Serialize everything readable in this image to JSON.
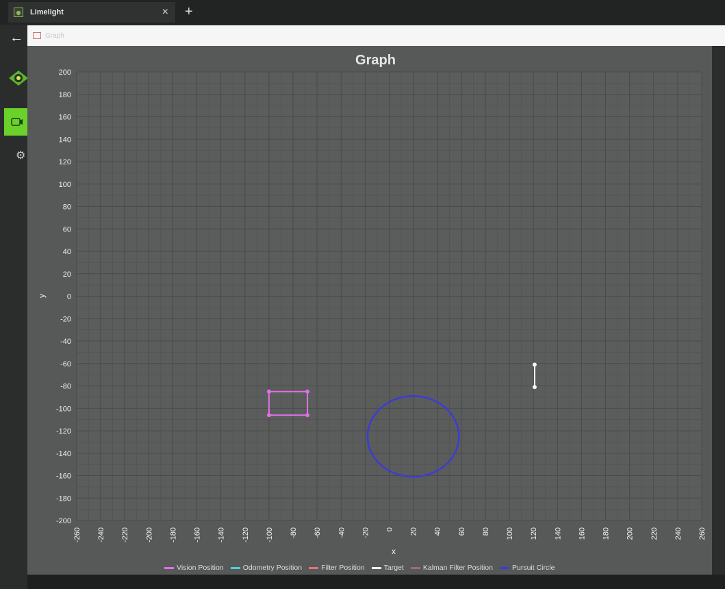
{
  "window": {
    "tab_title": "Limelight",
    "tab_close": "×",
    "new_tab": "+"
  },
  "sidebar": {
    "back_icon": "arrow-left-icon",
    "items": [
      {
        "name": "limelight-logo-icon"
      },
      {
        "name": "camera-icon",
        "active": true
      },
      {
        "name": "gear-icon"
      }
    ]
  },
  "address_bar": {
    "page_name": "Graph"
  },
  "colors": {
    "active_green": "#6ad12a",
    "vision": "#e070e6",
    "odometry": "#4dd0e1",
    "filter": "#e57373",
    "target": "#f5f5f5",
    "kalman": "#a56a78",
    "pursuit": "#3d3bd6"
  },
  "graph": {
    "title": "Graph",
    "xlabel": "x",
    "ylabel": "y"
  },
  "chart_data": {
    "type": "scatter",
    "title": "Graph",
    "xlabel": "x",
    "ylabel": "y",
    "xlim": [
      -260,
      260
    ],
    "ylim": [
      -200,
      200
    ],
    "x_ticks": [
      -260,
      -240,
      -220,
      -200,
      -180,
      -160,
      -140,
      -120,
      -100,
      -80,
      -60,
      -40,
      -20,
      0,
      20,
      40,
      60,
      80,
      100,
      120,
      140,
      160,
      180,
      200,
      220,
      240,
      260
    ],
    "y_ticks": [
      200,
      180,
      160,
      140,
      120,
      100,
      80,
      60,
      40,
      20,
      0,
      -20,
      -40,
      -60,
      -80,
      -100,
      -120,
      -140,
      -160,
      -180,
      -200
    ],
    "grid": true,
    "legend_placement": "bottom",
    "series": [
      {
        "name": "Vision Position",
        "color": "#e070e6",
        "shape": "rectangle",
        "points": [
          [
            -100,
            -85
          ],
          [
            -68,
            -85
          ],
          [
            -68,
            -106
          ],
          [
            -100,
            -106
          ],
          [
            -100,
            -85
          ]
        ]
      },
      {
        "name": "Odometry Position",
        "color": "#4dd0e1",
        "points": []
      },
      {
        "name": "Filter Position",
        "color": "#e57373",
        "points": []
      },
      {
        "name": "Target",
        "color": "#f5f5f5",
        "points": [
          [
            121,
            -61
          ],
          [
            121,
            -81
          ]
        ]
      },
      {
        "name": "Kalman Filter Position",
        "color": "#a56a78",
        "points": []
      },
      {
        "name": "Pursuit Circle",
        "color": "#3d3bd6",
        "shape": "ellipse",
        "center": [
          20,
          -125
        ],
        "radius_x": 38,
        "radius_y": 36
      }
    ]
  }
}
